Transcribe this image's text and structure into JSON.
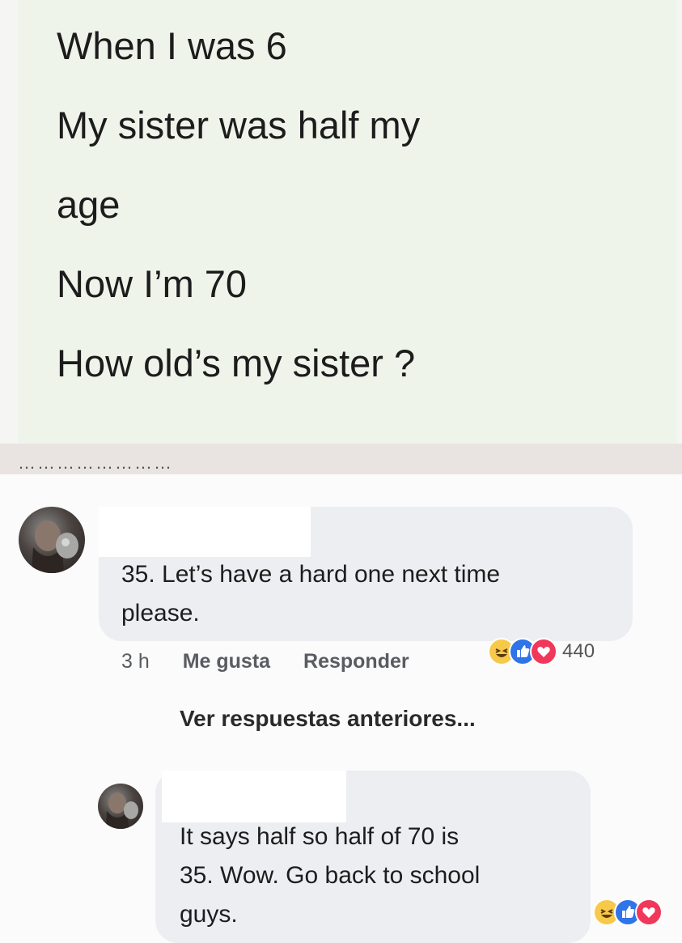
{
  "post": {
    "lines": [
      "When I was 6",
      "My sister was half my",
      "age",
      "Now I’m 70",
      "How old’s my sister ?"
    ]
  },
  "cut_header": "……………………",
  "comment1": {
    "text_line1": "35. Let’s have a hard one next time",
    "text_line2": "please.",
    "time": "3 h",
    "like": "Me gusta",
    "reply": "Responder",
    "reaction_count": "440",
    "reactions": [
      "haha-icon",
      "like-icon",
      "love-icon"
    ]
  },
  "view_previous": "Ver respuestas anteriores...",
  "comment2": {
    "text_line1": "It says half so half of 70 is",
    "text_line2": "35. Wow. Go back to school",
    "text_line3": "guys.",
    "reactions": [
      "haha-icon",
      "like-icon",
      "love-icon"
    ]
  },
  "colors": {
    "post_bg": "#eef4ea",
    "bubble_bg": "#eceef1",
    "like_blue": "#2f74e8",
    "love_red": "#f0385a",
    "haha_yellow": "#f7c94b"
  }
}
